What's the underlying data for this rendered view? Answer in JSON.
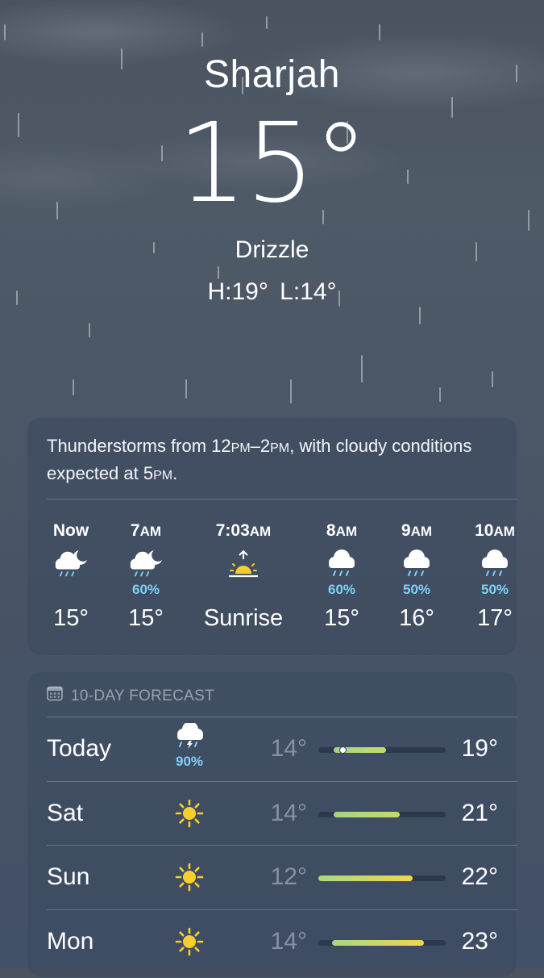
{
  "location": {
    "city": "Sharjah",
    "temperature": "15°",
    "condition": "Drizzle",
    "high_low": "H:19°  L:14°"
  },
  "hourly_card": {
    "summary": {
      "part1": "Thunderstorms from 12",
      "pm1": "PM",
      "dash": "–2",
      "pm2": "PM",
      "part2": ", with cloudy conditions expected at 5",
      "pm3": "PM",
      "end": "."
    },
    "hours": [
      {
        "time": "Now",
        "ampm": "",
        "icon": "cloud-moon-rain-icon",
        "pct": "",
        "value": "15°"
      },
      {
        "time": "7",
        "ampm": "AM",
        "icon": "cloud-moon-rain-icon",
        "pct": "60%",
        "value": "15°"
      },
      {
        "time": "7:03",
        "ampm": "AM",
        "icon": "sunrise-icon",
        "pct": "",
        "value": "Sunrise"
      },
      {
        "time": "8",
        "ampm": "AM",
        "icon": "cloud-rain-icon",
        "pct": "60%",
        "value": "15°"
      },
      {
        "time": "9",
        "ampm": "AM",
        "icon": "cloud-rain-icon",
        "pct": "50%",
        "value": "16°"
      },
      {
        "time": "10",
        "ampm": "AM",
        "icon": "cloud-rain-icon",
        "pct": "50%",
        "value": "17°"
      }
    ]
  },
  "daily_card": {
    "header_icon": "calendar-icon",
    "header": "10-DAY FORECAST",
    "days": [
      {
        "day": "Today",
        "icon": "cloud-bolt-rain-icon",
        "pct": "90%",
        "low": "14°",
        "high": "19°",
        "range_start": 0.12,
        "range_end": 0.53,
        "current": 0.19
      },
      {
        "day": "Sat",
        "icon": "sun-icon",
        "pct": "",
        "low": "14°",
        "high": "21°",
        "range_start": 0.12,
        "range_end": 0.64
      },
      {
        "day": "Sun",
        "icon": "sun-icon",
        "pct": "",
        "low": "12°",
        "high": "22°",
        "range_start": 0.0,
        "range_end": 0.74
      },
      {
        "day": "Mon",
        "icon": "sun-icon",
        "pct": "",
        "low": "14°",
        "high": "23°",
        "range_start": 0.11,
        "range_end": 0.83
      }
    ]
  },
  "colors": {
    "precip": "#7fd0f5",
    "sun": "#f7cf2a",
    "bar_green": "#a8d884",
    "bar_yellow": "#f2d64a"
  }
}
